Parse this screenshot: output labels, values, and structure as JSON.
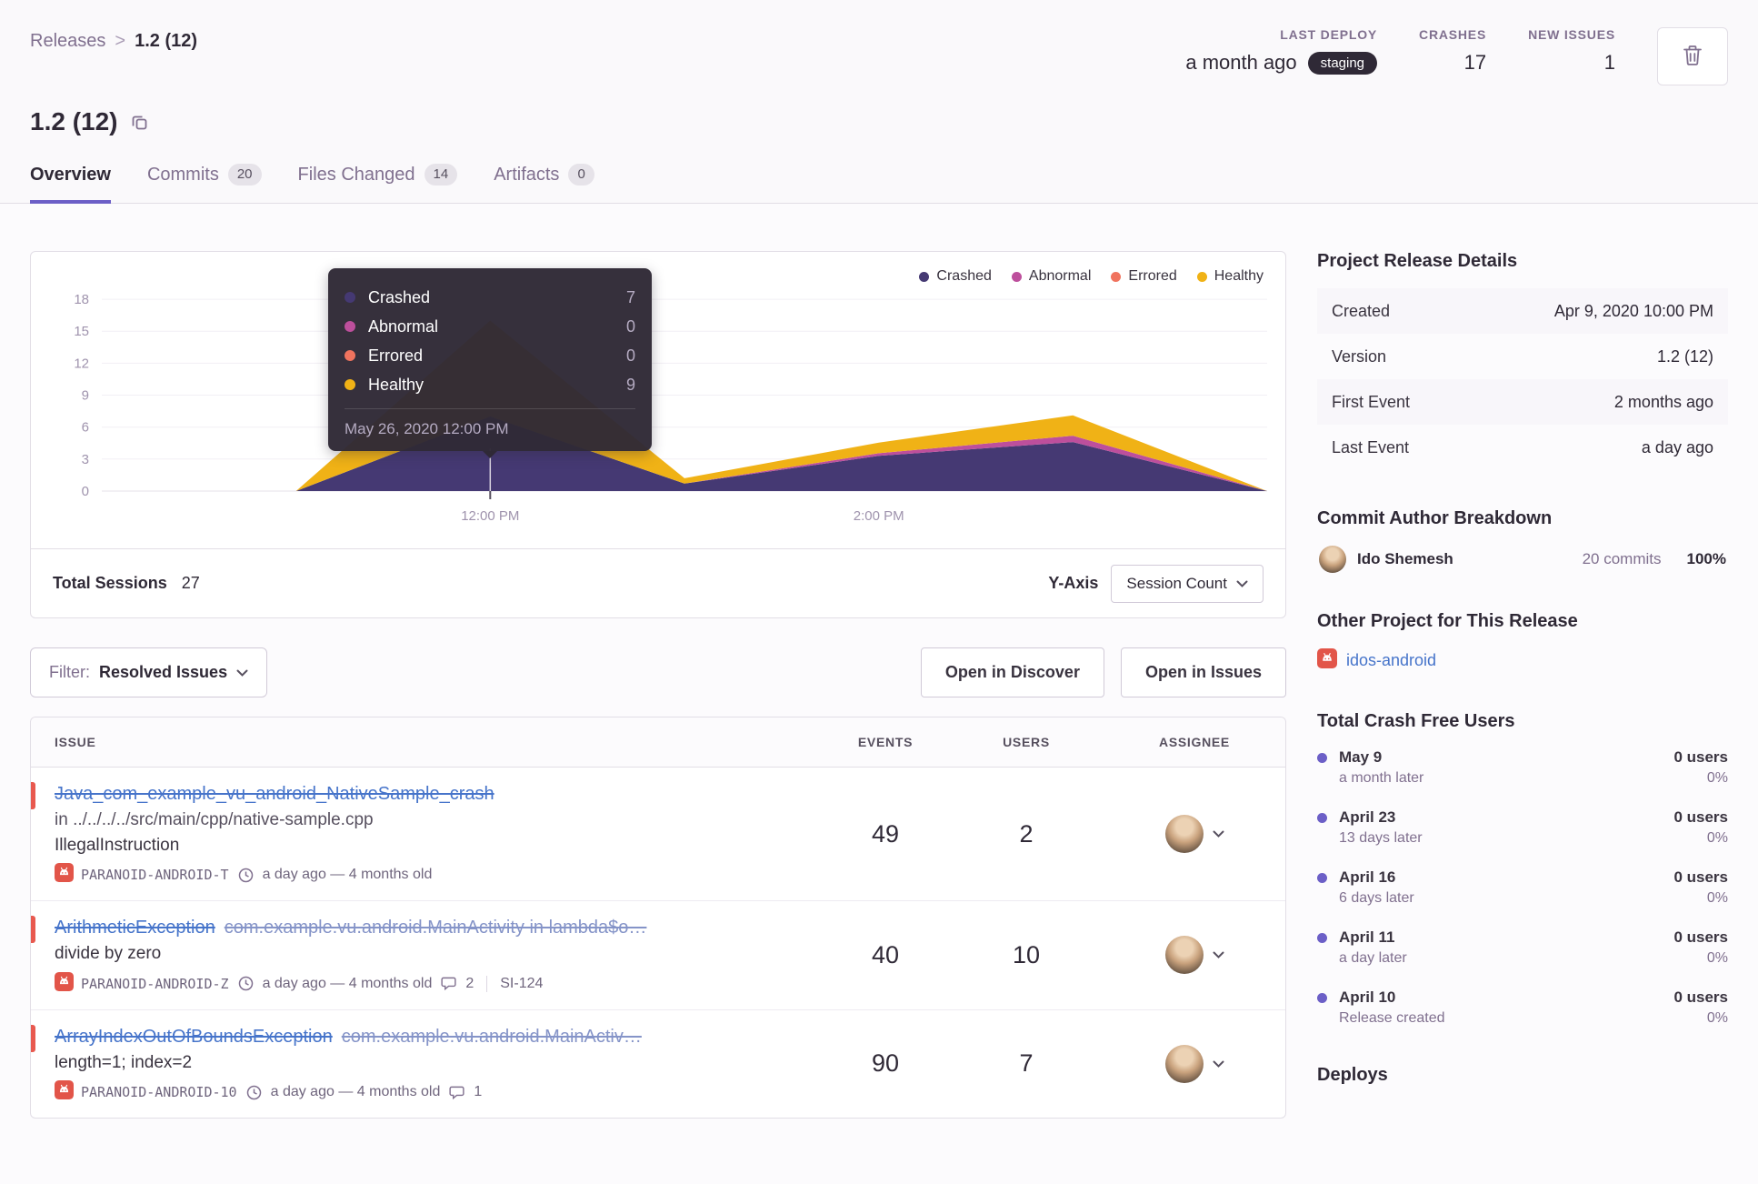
{
  "breadcrumb": {
    "parent": "Releases",
    "separator": ">",
    "current": "1.2 (12)"
  },
  "page": {
    "title": "1.2 (12)"
  },
  "header_stats": [
    {
      "label": "LAST DEPLOY",
      "value": "a month ago",
      "badge": "staging"
    },
    {
      "label": "CRASHES",
      "value": "17"
    },
    {
      "label": "NEW ISSUES",
      "value": "1"
    }
  ],
  "tabs": [
    {
      "label": "Overview"
    },
    {
      "label": "Commits",
      "badge": "20"
    },
    {
      "label": "Files Changed",
      "badge": "14"
    },
    {
      "label": "Artifacts",
      "badge": "0"
    }
  ],
  "chart": {
    "tooltip": {
      "rows": [
        {
          "label": "Crashed",
          "value": "7"
        },
        {
          "label": "Abnormal",
          "value": "0"
        },
        {
          "label": "Errored",
          "value": "0"
        },
        {
          "label": "Healthy",
          "value": "9"
        }
      ],
      "date": "May 26, 2020 12:00 PM"
    },
    "total_sessions_label": "Total Sessions",
    "total_sessions_value": "27",
    "y_axis_label": "Y-Axis",
    "y_axis_selected": "Session Count"
  },
  "chart_data": {
    "type": "area",
    "stacked": true,
    "x": [
      0,
      1,
      2,
      3,
      4,
      5,
      6
    ],
    "x_range": [
      0,
      6
    ],
    "x_axis_ticks": [
      {
        "label": "12:00 PM",
        "pos": 2
      },
      {
        "label": "2:00 PM",
        "pos": 4
      }
    ],
    "y_ticks": [
      0,
      3,
      6,
      9,
      12,
      15,
      18
    ],
    "ylim": [
      0,
      19.2
    ],
    "grid": true,
    "legend_position": "top-right",
    "tooltip_x": 2,
    "series": [
      {
        "name": "Crashed",
        "color": "#453973",
        "values": [
          0,
          0,
          7,
          0.7,
          3.3,
          4.6,
          0
        ]
      },
      {
        "name": "Abnormal",
        "color": "#bd4f9c",
        "values": [
          0,
          0,
          0,
          0,
          0.25,
          0.6,
          0
        ]
      },
      {
        "name": "Errored",
        "color": "#f0735e",
        "values": [
          0,
          0,
          0,
          0,
          0,
          0,
          0
        ]
      },
      {
        "name": "Healthy",
        "color": "#f0b216",
        "values": [
          0,
          0,
          9,
          0.5,
          1.0,
          1.9,
          0
        ]
      }
    ]
  },
  "filter_bar": {
    "filter_label": "Filter:",
    "filter_value": "Resolved Issues",
    "buttons": [
      "Open in Discover",
      "Open in Issues"
    ]
  },
  "issues": {
    "columns": [
      "ISSUE",
      "EVENTS",
      "USERS",
      "ASSIGNEE"
    ],
    "rows": [
      {
        "title": "Java_com_example_vu_android_NativeSample_crash",
        "subtitle": "in ../../../../src/main/cpp/native-sample.cpp",
        "culprit": "IllegalInstruction",
        "tag": "PARANOID-ANDROID-T",
        "age": "a day ago — 4 months old",
        "events": "49",
        "users": "2"
      },
      {
        "title": "ArithmeticException",
        "title_secondary": "com.example.vu.android.MainActivity in lambda$o…",
        "culprit": "divide by zero",
        "tag": "PARANOID-ANDROID-Z",
        "age": "a day ago — 4 months old",
        "comments": "2",
        "annotation": "SI-124",
        "events": "40",
        "users": "10"
      },
      {
        "title": "ArrayIndexOutOfBoundsException",
        "title_secondary": "com.example.vu.android.MainActiv…",
        "culprit": "length=1; index=2",
        "tag": "PARANOID-ANDROID-10",
        "age": "a day ago — 4 months old",
        "comments": "1",
        "events": "90",
        "users": "7"
      }
    ]
  },
  "sidebar": {
    "release_details": {
      "heading": "Project Release Details",
      "rows": [
        {
          "label": "Created",
          "value": "Apr 9, 2020 10:00 PM"
        },
        {
          "label": "Version",
          "value": "1.2 (12)"
        },
        {
          "label": "First Event",
          "value": "2 months ago"
        },
        {
          "label": "Last Event",
          "value": "a day ago"
        }
      ]
    },
    "commit_authors": {
      "heading": "Commit Author Breakdown",
      "authors": [
        {
          "name": "Ido Shemesh",
          "commits": "20 commits",
          "percent": "100%"
        }
      ]
    },
    "other_projects": {
      "heading": "Other Project for This Release",
      "projects": [
        {
          "name": "idos-android"
        }
      ]
    },
    "crash_free": {
      "heading": "Total Crash Free Users",
      "items": [
        {
          "date": "May 9",
          "relative": "a month later",
          "users": "0 users",
          "percent": "0%"
        },
        {
          "date": "April 23",
          "relative": "13 days later",
          "users": "0 users",
          "percent": "0%"
        },
        {
          "date": "April 16",
          "relative": "6 days later",
          "users": "0 users",
          "percent": "0%"
        },
        {
          "date": "April 11",
          "relative": "a day later",
          "users": "0 users",
          "percent": "0%"
        },
        {
          "date": "April 10",
          "relative": "Release created",
          "users": "0 users",
          "percent": "0%"
        }
      ]
    },
    "deploys_heading": "Deploys"
  }
}
